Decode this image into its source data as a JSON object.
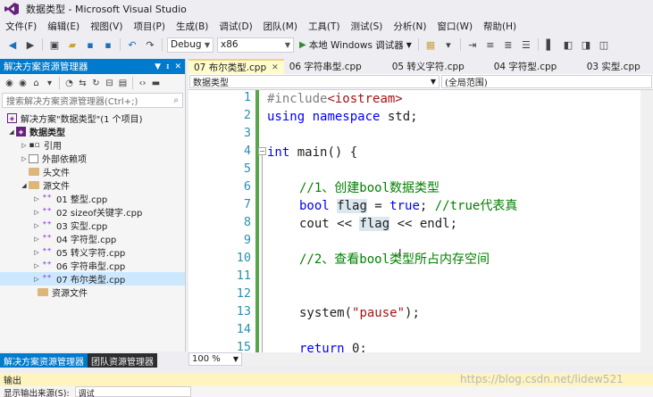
{
  "window": {
    "title": "数据类型 - Microsoft Visual Studio"
  },
  "menu": [
    "文件(F)",
    "编辑(E)",
    "视图(V)",
    "项目(P)",
    "生成(B)",
    "调试(D)",
    "团队(M)",
    "工具(T)",
    "测试(S)",
    "分析(N)",
    "窗口(W)",
    "帮助(H)"
  ],
  "toolbar": {
    "config": "Debug",
    "platform": "x86",
    "run_label": "本地 Windows 调试器"
  },
  "solution_explorer": {
    "title": "解决方案资源管理器",
    "search_placeholder": "搜索解决方案资源管理器(Ctrl+;)",
    "solution": "解决方案\"数据类型\"(1 个项目)",
    "project": "数据类型",
    "nodes": {
      "references": "引用",
      "external": "外部依赖项",
      "headers": "头文件",
      "sources": "源文件",
      "resources": "资源文件"
    },
    "files": [
      "01 整型.cpp",
      "02 sizeof关键字.cpp",
      "03 实型.cpp",
      "04 字符型.cpp",
      "05 转义字符.cpp",
      "06 字符串型.cpp",
      "07 布尔类型.cpp"
    ],
    "tabs": [
      "解决方案资源管理器",
      "团队资源管理器"
    ]
  },
  "editor": {
    "tabs": [
      "07 布尔类型.cpp",
      "06 字符串型.cpp",
      "05 转义字符.cpp",
      "04 字符型.cpp",
      "03 实型.cpp"
    ],
    "nav_left": "数据类型",
    "nav_right": "(全局范围)",
    "zoom": "100 %",
    "line_numbers": [
      "1",
      "2",
      "3",
      "4",
      "5",
      "6",
      "7",
      "8",
      "9",
      "10",
      "11",
      "12",
      "13",
      "14",
      "15"
    ],
    "code": {
      "l1_pp": "#include",
      "l1_str": "<iostream>",
      "l2_kw1": "using",
      "l2_kw2": "namespace",
      "l2_rest": " std;",
      "l4_kw": "int",
      "l4_rest": " main() {",
      "l6_cm": "//1、创建bool数据类型",
      "l7_kw": "bool",
      "l7_var": "flag",
      "l7_mid": " = ",
      "l7_true": "true",
      "l7_semi": "; ",
      "l7_cm": "//true代表真",
      "l8_a": "cout << ",
      "l8_var": "flag",
      "l8_b": " << endl;",
      "l10_cm": "//2、查看bool类型所占内存空间",
      "l13_a": "system(",
      "l13_str": "\"pause\"",
      "l13_b": ");",
      "l15_kw": "return",
      "l15_rest": " 0;"
    }
  },
  "output": {
    "title": "输出",
    "source_label": "显示输出来源(S):",
    "source_value": "调试"
  },
  "watermark": "https://blog.csdn.net/lidew521"
}
